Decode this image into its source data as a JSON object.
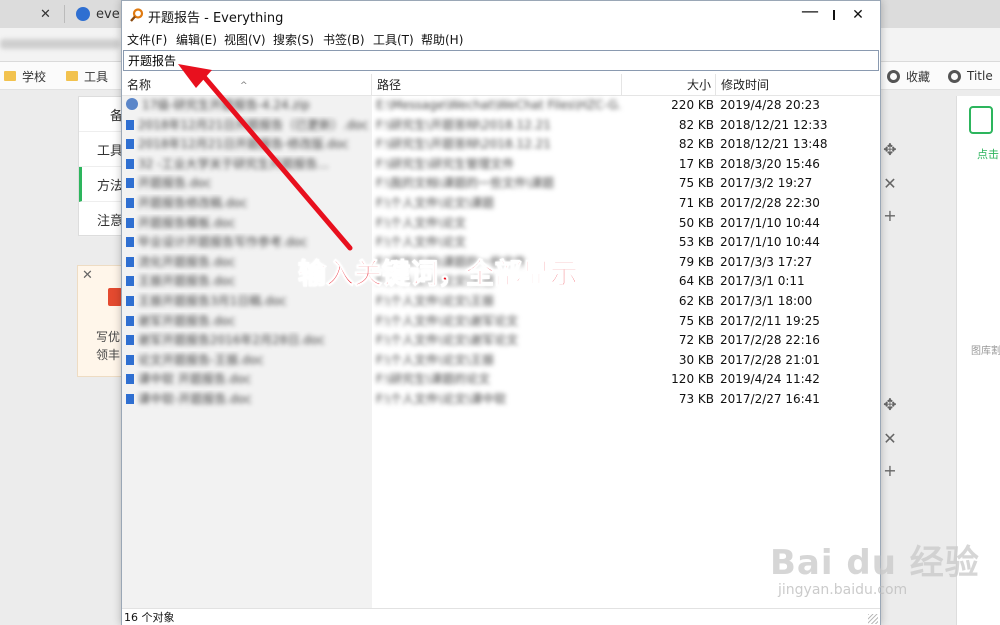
{
  "browser": {
    "tab_text": "eve",
    "bookmarks": [
      {
        "label": "学校"
      },
      {
        "label": "工具"
      },
      {
        "label": "收藏"
      },
      {
        "label": "Title"
      }
    ],
    "left_menu": [
      "备",
      "工具",
      "方法",
      "注意"
    ],
    "ad_text": [
      "写优",
      "领丰"
    ],
    "right_panel_text": "点击",
    "right_panel_text2": "图库割"
  },
  "window": {
    "title": "开题报告 - Everything",
    "minimize": "—",
    "maximize": "☐",
    "close": "✕",
    "menus": [
      "文件(F)",
      "编辑(E)",
      "视图(V)",
      "搜索(S)",
      "书签(B)",
      "工具(T)",
      "帮助(H)"
    ],
    "search_value": "开题报告",
    "columns": {
      "name": "名称",
      "path": "路径",
      "size": "大小",
      "modified": "修改时间"
    },
    "rows": [
      {
        "name": "17级-研究生开题报告-4.24.zip",
        "path": "E:\\Message\\Wechat\\WeChat Files\\HZC-G...",
        "size": "220 KB",
        "modified": "2019/4/28 20:23",
        "icon": "zip"
      },
      {
        "name": "2018年12月21日开题报告（已更新）.doc",
        "path": "F:\\研究生\\开题答辩\\2018.12.21",
        "size": "82 KB",
        "modified": "2018/12/21 12:33",
        "icon": "doc"
      },
      {
        "name": "2018年12月21日开题报告-修改版.doc",
        "path": "F:\\研究生\\开题答辩\\2018.12.21",
        "size": "82 KB",
        "modified": "2018/12/21 13:48",
        "icon": "doc"
      },
      {
        "name": "32 -工业大学关于研究生开题报告...",
        "path": "F:\\研究生\\研究生管理文件",
        "size": "17 KB",
        "modified": "2018/3/20 15:46",
        "icon": "doc"
      },
      {
        "name": "开题报告.doc",
        "path": "F:\\我的文档\\课题的一些文件\\课题",
        "size": "75 KB",
        "modified": "2017/3/2 19:27",
        "icon": "doc"
      },
      {
        "name": "开题报告修改稿.doc",
        "path": "F:\\个人文件\\论文\\课题",
        "size": "71 KB",
        "modified": "2017/2/28 22:30",
        "icon": "doc"
      },
      {
        "name": "开题报告模板.doc",
        "path": "F:\\个人文件\\论文",
        "size": "50 KB",
        "modified": "2017/1/10 10:44",
        "icon": "doc"
      },
      {
        "name": "毕业设计开题报告写作参考.doc",
        "path": "F:\\个人文件\\论文",
        "size": "53 KB",
        "modified": "2017/1/10 10:44",
        "icon": "doc"
      },
      {
        "name": "流化开题报告.doc",
        "path": "F:\\我的文档\\课题的一些文件",
        "size": "79 KB",
        "modified": "2017/3/3 17:27",
        "icon": "doc"
      },
      {
        "name": "王振开题报告.doc",
        "path": "F:\\个人文件\\论文\\课题",
        "size": "64 KB",
        "modified": "2017/3/1 0:11",
        "icon": "doc"
      },
      {
        "name": "王振开题报告3月1日稿.doc",
        "path": "F:\\个人文件\\论文\\王振",
        "size": "62 KB",
        "modified": "2017/3/1 18:00",
        "icon": "doc"
      },
      {
        "name": "谢军开题报告.doc",
        "path": "F:\\个人文件\\论文\\谢军论文",
        "size": "75 KB",
        "modified": "2017/2/11 19:25",
        "icon": "doc"
      },
      {
        "name": "谢军开题报告2016年2月28日.doc",
        "path": "F:\\个人文件\\论文\\谢军论文",
        "size": "72 KB",
        "modified": "2017/2/28 22:16",
        "icon": "doc"
      },
      {
        "name": "论文开题报告-王振.doc",
        "path": "F:\\个人文件\\论文\\王振",
        "size": "30 KB",
        "modified": "2017/2/28 21:01",
        "icon": "doc"
      },
      {
        "name": "课中软 开题报告.doc",
        "path": "F:\\研究生\\课题的论文",
        "size": "120 KB",
        "modified": "2019/4/24 11:42",
        "icon": "doc"
      },
      {
        "name": "课中软-开题报告.doc",
        "path": "F:\\个人文件\\论文\\课中软",
        "size": "73 KB",
        "modified": "2017/2/27 16:41",
        "icon": "doc"
      }
    ],
    "status": "16 个对象"
  },
  "annotation": {
    "text": "输入关键词，全部显示",
    "color": "#e8101e"
  },
  "watermark": {
    "logo": "Bai du 经验",
    "url": "jingyan.baidu.com"
  }
}
